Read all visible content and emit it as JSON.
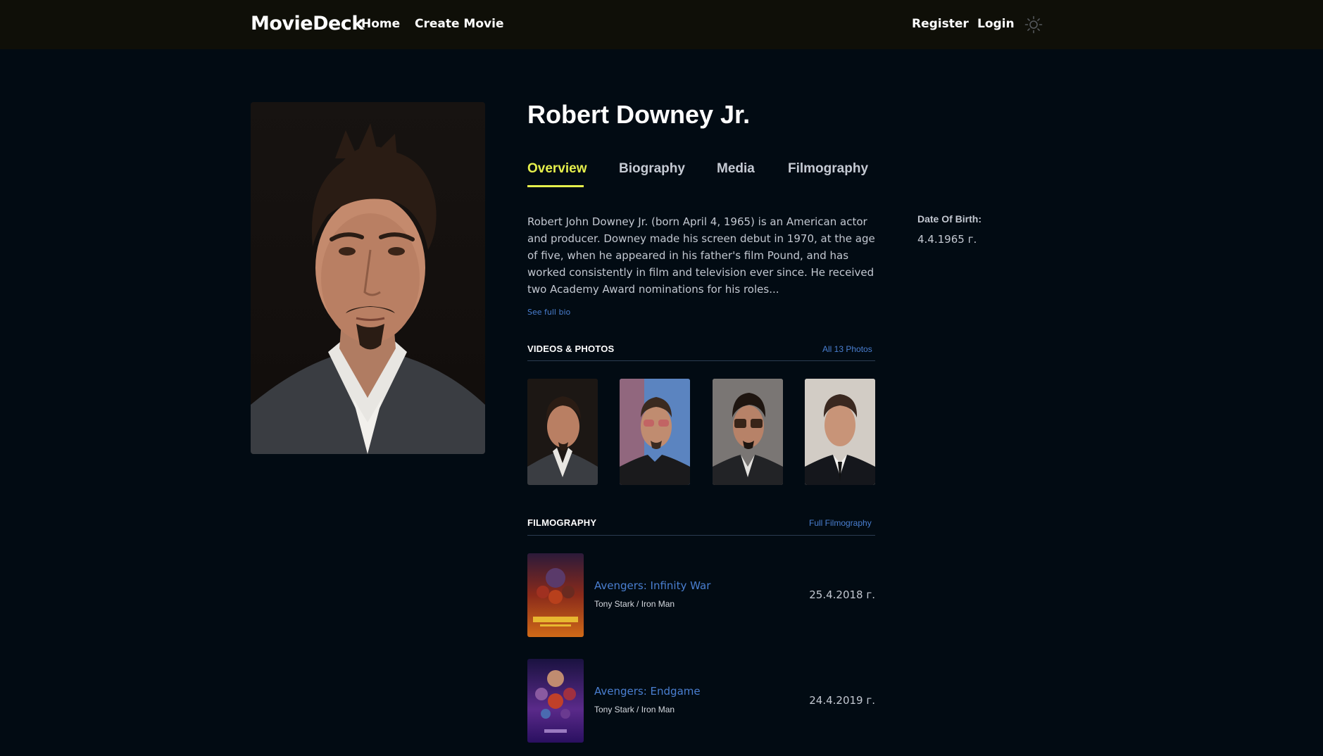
{
  "navbar": {
    "brand": "MovieDeck",
    "links": [
      {
        "label": "Home"
      },
      {
        "label": "Create Movie"
      },
      {
        "label": "Register"
      },
      {
        "label": "Login"
      }
    ],
    "theme_icon": "sun-icon"
  },
  "person": {
    "name": "Robert Downey Jr.",
    "bio": "Robert John Downey Jr. (born April 4, 1965) is an American actor and producer. Downey made his screen debut in 1970, at the age of five, when he appeared in his father's film Pound, and has worked consistently in film and television ever since. He received two Academy Award nominations for his roles...",
    "see_full_bio": "See full bio",
    "dob_label": "Date Of Birth:",
    "dob_value": "4.4.1965 г."
  },
  "tabs": [
    {
      "label": "Overview",
      "active": true
    },
    {
      "label": "Biography"
    },
    {
      "label": "Media"
    },
    {
      "label": "Filmography"
    }
  ],
  "media": {
    "title": "VIDEOS & PHOTOS",
    "link": "All 13 Photos"
  },
  "filmography": {
    "title": "FILMOGRAPHY",
    "link": "Full Filmography",
    "items": [
      {
        "title": "Avengers: Infinity War",
        "role": "Tony Stark / Iron Man",
        "date": "25.4.2018 г."
      },
      {
        "title": "Avengers: Endgame",
        "role": "Tony Stark / Iron Man",
        "date": "24.4.2019 г."
      }
    ]
  },
  "colors": {
    "background": "#020b13",
    "navbar": "#0f0f08",
    "accent": "#e6f04c",
    "link": "#4a7fd1",
    "text_muted": "#c3c8d1"
  }
}
